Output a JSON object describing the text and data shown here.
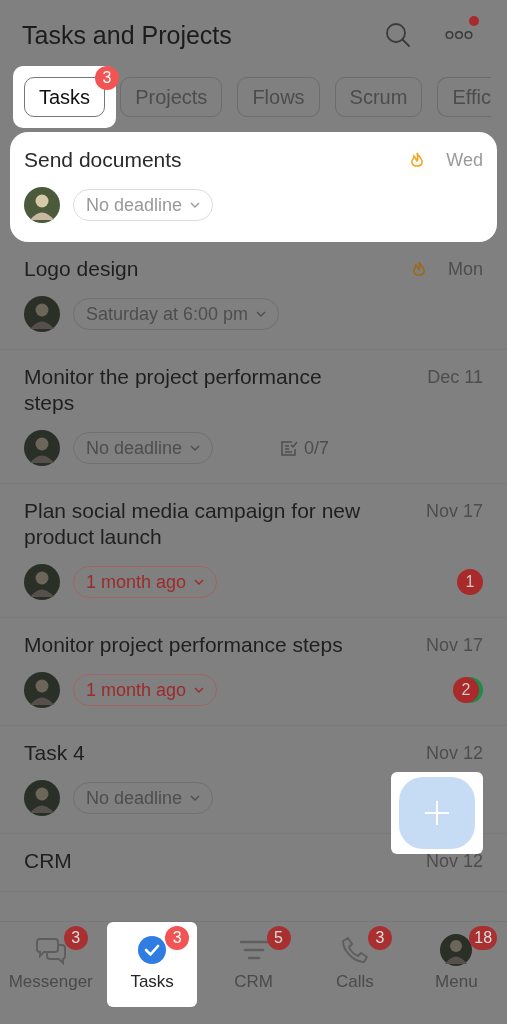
{
  "header": {
    "title": "Tasks and Projects",
    "notification_dot": true
  },
  "filters": [
    {
      "label": "Tasks",
      "selected": true,
      "highlighted": true,
      "badge": "3"
    },
    {
      "label": "Projects",
      "selected": false,
      "highlighted": false
    },
    {
      "label": "Flows",
      "selected": false,
      "highlighted": false
    },
    {
      "label": "Scrum",
      "selected": false,
      "highlighted": false
    },
    {
      "label": "Effic",
      "selected": false,
      "highlighted": false
    }
  ],
  "tasks": [
    {
      "title": "Send documents",
      "date": "Wed",
      "hot": true,
      "deadline": "No deadline",
      "overdue": false,
      "highlighted": true
    },
    {
      "title": "Logo design",
      "date": "Mon",
      "hot": true,
      "deadline": "Saturday at 6:00 pm",
      "overdue": false,
      "highlighted": false
    },
    {
      "title": "Monitor the project performance steps",
      "date": "Dec 11",
      "hot": false,
      "deadline": "No deadline",
      "overdue": false,
      "checklist": "0/7",
      "highlighted": false
    },
    {
      "title": "Plan social media campaign for new product launch",
      "date": "Nov 17",
      "hot": false,
      "deadline": "1 month ago",
      "overdue": true,
      "counter": "1",
      "counter_ring": false,
      "highlighted": false
    },
    {
      "title": "Monitor project performance steps",
      "date": "Nov 17",
      "hot": false,
      "deadline": "1 month ago",
      "overdue": true,
      "counter": "2",
      "counter_ring": true,
      "highlighted": false
    },
    {
      "title": "Task 4",
      "date": "Nov 12",
      "hot": false,
      "deadline": "No deadline",
      "overdue": false,
      "highlighted": false
    },
    {
      "title": "CRM",
      "date": "Nov 12",
      "hot": false,
      "highlighted": false
    }
  ],
  "fab": {
    "highlighted": true
  },
  "tabbar": [
    {
      "kind": "messenger",
      "label": "Messenger",
      "badge": "3",
      "selected": false,
      "highlighted": false
    },
    {
      "kind": "tasks",
      "label": "Tasks",
      "badge": "3",
      "selected": true,
      "highlighted": true
    },
    {
      "kind": "crm",
      "label": "CRM",
      "badge": "5",
      "selected": false,
      "highlighted": false
    },
    {
      "kind": "calls",
      "label": "Calls",
      "badge": "3",
      "selected": false,
      "highlighted": false
    },
    {
      "kind": "menu",
      "label": "Menu",
      "badge": "18",
      "selected": false,
      "highlighted": false
    }
  ]
}
